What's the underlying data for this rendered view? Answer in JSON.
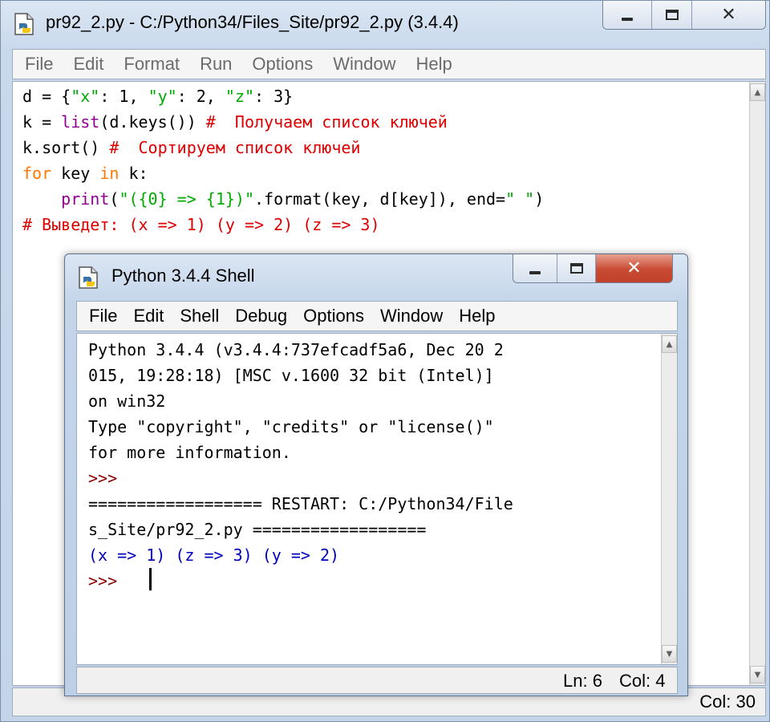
{
  "editor": {
    "title": "pr92_2.py - C:/Python34/Files_Site/pr92_2.py (3.4.4)",
    "menu": [
      "File",
      "Edit",
      "Format",
      "Run",
      "Options",
      "Window",
      "Help"
    ],
    "code": {
      "line1": {
        "a": "d = {",
        "b": "\"x\"",
        "c": ": 1, ",
        "d": "\"y\"",
        "e": ": 2, ",
        "f": "\"z\"",
        "g": ": 3}"
      },
      "line2": {
        "a": "k = ",
        "b": "list",
        "c": "(d.keys()) ",
        "d": "#  Получаем список ключей"
      },
      "line3": {
        "a": "k.sort() ",
        "b": "#  Сортируем список ключей"
      },
      "line4": {
        "a": "for",
        "b": " key ",
        "c": "in",
        "d": " k:"
      },
      "line5": {
        "a": "    ",
        "b": "print",
        "c": "(",
        "d": "\"({0} => {1})\"",
        "e": ".format(key, d[key]), end=",
        "f": "\" \"",
        "g": ")"
      },
      "line6": {
        "a": "# Выведет: (x => 1) (y => 2) (z => 3)"
      }
    },
    "status": {
      "col": "Col: 30"
    },
    "controls": {
      "minimize": "minimize",
      "maximize": "maximize",
      "close": "close"
    }
  },
  "shell": {
    "title": "Python 3.4.4 Shell",
    "menu": [
      "File",
      "Edit",
      "Shell",
      "Debug",
      "Options",
      "Window",
      "Help"
    ],
    "output": [
      "Python 3.4.4 (v3.4.4:737efcadf5a6, Dec 20 2",
      "015, 19:28:18) [MSC v.1600 32 bit (Intel)]",
      "on win32",
      "Type \"copyright\", \"credits\" or \"license()\"",
      "for more information.",
      ">>>",
      "================== RESTART: C:/Python34/File",
      "s_Site/pr92_2.py ==================",
      "(x => 1) (z => 3) (y => 2)",
      ">>>"
    ],
    "status": {
      "ln": "Ln: 6",
      "col": "Col: 4"
    }
  },
  "colors": {
    "keyword": "#ff7700",
    "builtin": "#900090",
    "string": "#00aa00",
    "comment": "#dd0000",
    "shell_output": "#0000c0",
    "prompt": "#8b0000"
  },
  "icons": [
    "python-file-icon",
    "minimize-icon",
    "maximize-icon",
    "close-icon",
    "scroll-up-icon",
    "scroll-down-icon"
  ]
}
